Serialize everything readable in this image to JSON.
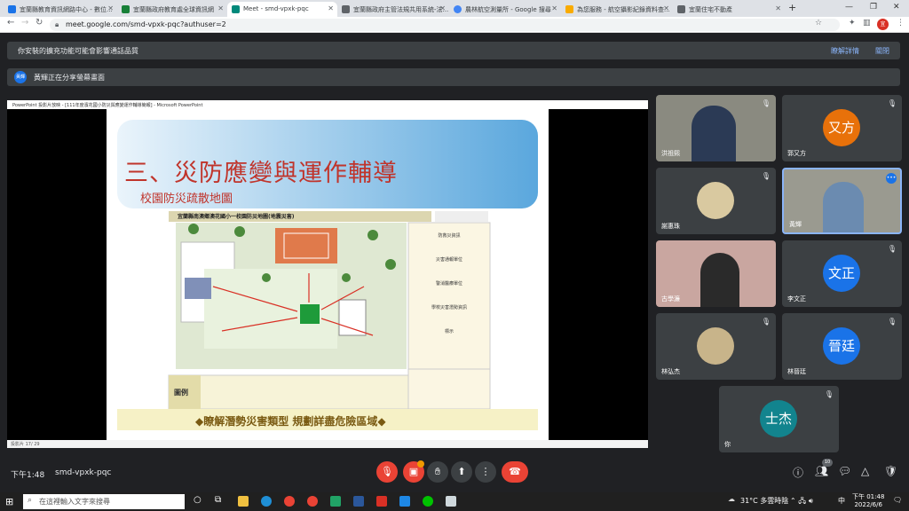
{
  "browser": {
    "tabs": [
      {
        "title": "宜蘭縣教育資訊網路中心 - 數位...",
        "color": "#1a73e8",
        "active": false
      },
      {
        "title": "宜蘭縣政府教育處全球資訊網",
        "color": "#188038",
        "active": false
      },
      {
        "title": "Meet - smd-vpxk-pqc",
        "color": "#00897b",
        "active": true
      },
      {
        "title": "宜蘭縣政府主管法規共用系統-法...",
        "color": "#5f6368",
        "active": false
      },
      {
        "title": "農林航空測量所 - Google 搜尋",
        "color": "#4285f4",
        "active": false
      },
      {
        "title": "為您服務 - 航空攝影紀錄資料查...",
        "color": "#f9ab00",
        "active": false
      },
      {
        "title": "宜蘭住宅不動產",
        "color": "#5f6368",
        "active": false
      }
    ],
    "new_tab": "+",
    "url": "meet.google.com/smd-vpxk-pqc?authuser=2",
    "profile_initial": "宜"
  },
  "banners": {
    "extension_warning": "你安裝的擴充功能可能會影響通話品質",
    "learn_more": "瞭解詳情",
    "dismiss": "關閉",
    "presenter_badge": "黃輝",
    "presenting_text": "黃輝正在分享螢幕畫面"
  },
  "presentation": {
    "ppt_titlebar": "PowerPoint 投影片放映 - [111年度濱花國小防災與應變運作輔導簡報] - Microsoft PowerPoint",
    "slide_title": "三、災防應變與運作輔導",
    "slide_subtitle": "校園防災疏散地圖",
    "map_header": "宜蘭縣南澳鄉澳花國小一校園防災地圖(地震災害)",
    "legend_label": "圖例",
    "slide_footer": "◆瞭解潛勢災害類型 規劃詳盡危險區域◆",
    "status_text": "投影片 17/ 29",
    "info_sections": [
      "防救災資訊",
      "災害通報單位",
      "警消醫療單位",
      "學校災害潛勢資訊",
      "標示"
    ]
  },
  "participants": [
    {
      "name": "洪祖熙",
      "type": "video",
      "initial": ""
    },
    {
      "name": "郭又方",
      "type": "avatar",
      "initial": "又方",
      "color": "#e8710a"
    },
    {
      "name": "謝惠珠",
      "type": "photo",
      "initial": ""
    },
    {
      "name": "黃輝",
      "type": "video",
      "initial": ""
    },
    {
      "name": "古學濂",
      "type": "video",
      "initial": ""
    },
    {
      "name": "李文正",
      "type": "avatar",
      "initial": "文正",
      "color": "#1a73e8"
    },
    {
      "name": "林弘杰",
      "type": "photo",
      "initial": ""
    },
    {
      "name": "林晉廷",
      "type": "avatar",
      "initial": "晉廷",
      "color": "#1a73e8"
    },
    {
      "name": "你",
      "type": "avatar",
      "initial": "士杰",
      "color": "#12848e"
    }
  ],
  "bottombar": {
    "time": "下午1:48",
    "meeting_code": "smd-vpxk-pqc",
    "participant_count": "10",
    "icons": [
      "mic-off-icon",
      "camera-off-icon",
      "raise-hand-icon",
      "present-icon",
      "more-icon",
      "leave-call-icon",
      "info-icon",
      "people-icon",
      "chat-icon",
      "activities-icon",
      "host-controls-icon"
    ]
  },
  "taskbar": {
    "search_placeholder": "在這裡輸入文字來搜尋",
    "weather": "31°C 多雲時陰",
    "ime": "中",
    "clock_time": "下午 01:48",
    "clock_date": "2022/6/6"
  }
}
